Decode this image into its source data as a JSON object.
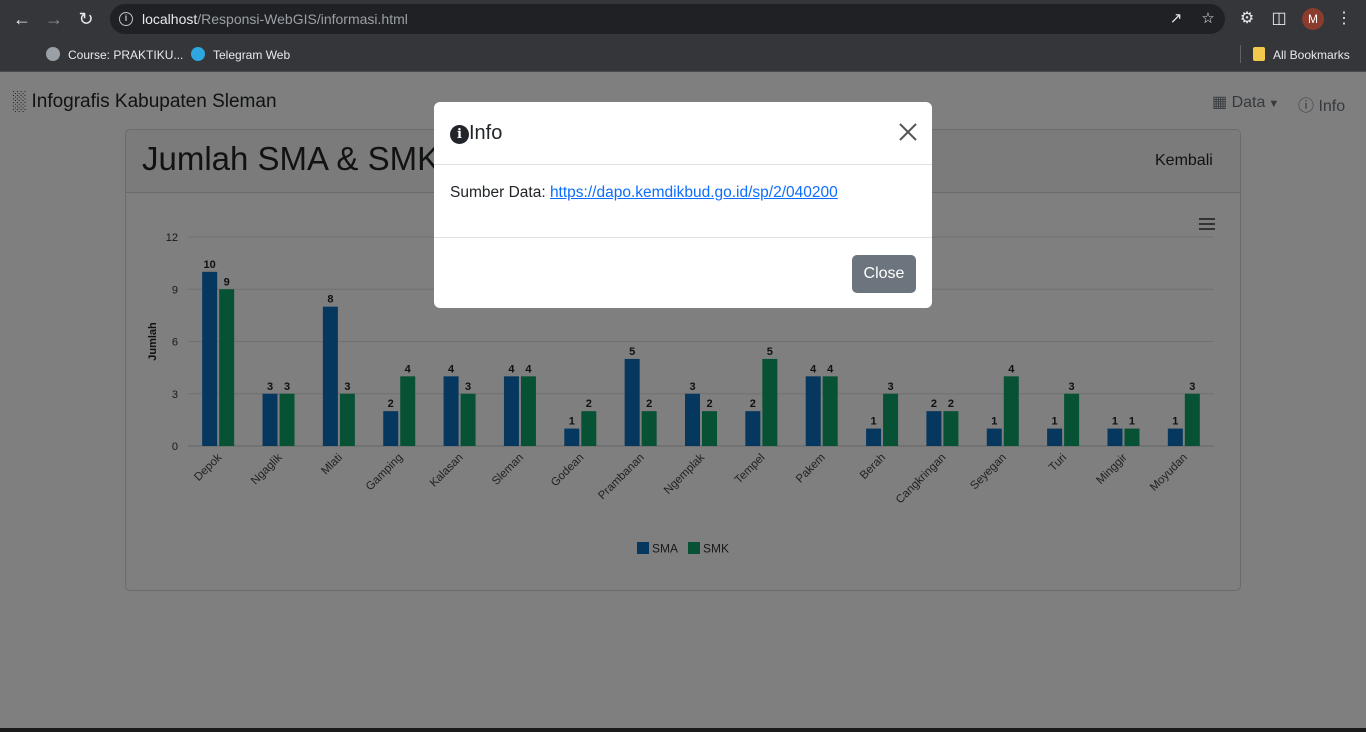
{
  "browser": {
    "url_host": "localhost",
    "url_path": "/Responsi-WebGIS/informasi.html",
    "avatar_letter": "M",
    "bookmarks": [
      {
        "label": "Course: PRAKTIKU..."
      },
      {
        "label": "Telegram Web"
      }
    ],
    "all_bookmarks": "All Bookmarks"
  },
  "navbar": {
    "brand": "Infografis Kabupaten Sleman",
    "data_label": "Data",
    "info_label": "Info"
  },
  "card": {
    "title": "Jumlah SMA & SMK",
    "back_label": "Kembali"
  },
  "modal": {
    "title": "Info",
    "body_prefix": "Sumber Data: ",
    "link_text": "https://dapo.kemdikbud.go.id/sp/2/040200",
    "close_label": "Close"
  },
  "chart_data": {
    "type": "bar",
    "categories": [
      "Depok",
      "Ngaglik",
      "Mlati",
      "Gamping",
      "Kalasan",
      "Sleman",
      "Godean",
      "Prambanan",
      "Ngemplak",
      "Tempel",
      "Pakem",
      "Berah",
      "Cangkringan",
      "Seyegan",
      "Turi",
      "Minggir",
      "Moyudan"
    ],
    "series": [
      {
        "name": "SMA",
        "values": [
          10,
          3,
          8,
          2,
          4,
          4,
          1,
          5,
          3,
          2,
          4,
          1,
          2,
          1,
          1,
          1,
          1
        ],
        "color": "#0d6ebf"
      },
      {
        "name": "SMK",
        "values": [
          9,
          3,
          3,
          4,
          3,
          4,
          2,
          2,
          2,
          5,
          4,
          3,
          2,
          4,
          3,
          1,
          3
        ],
        "color": "#0fa56b"
      }
    ],
    "ylabel": "Jumlah",
    "yticks": [
      0,
      3,
      6,
      9,
      12
    ],
    "ylim": [
      0,
      12
    ],
    "legend": "bottom-center",
    "grid": true
  }
}
